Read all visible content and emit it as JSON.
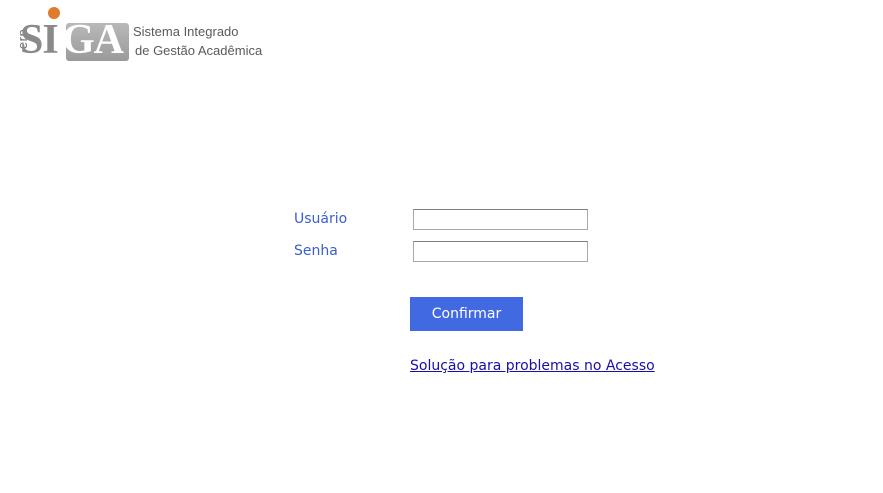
{
  "logo": {
    "erp": ".erp",
    "si": "SI",
    "ga": "GA",
    "line1": "Sistema Integrado",
    "line2": "de Gestão Acadêmica",
    "accent_color": "#e07a2c"
  },
  "login": {
    "username_label": "Usuário",
    "username_value": "",
    "password_label": "Senha",
    "password_value": "",
    "confirm_label": "Confirmar",
    "help_link": "Solução para problemas no Acesso"
  },
  "colors": {
    "label": "#3a5fcd",
    "button": "#4169e1",
    "link": "#1a0dab"
  }
}
